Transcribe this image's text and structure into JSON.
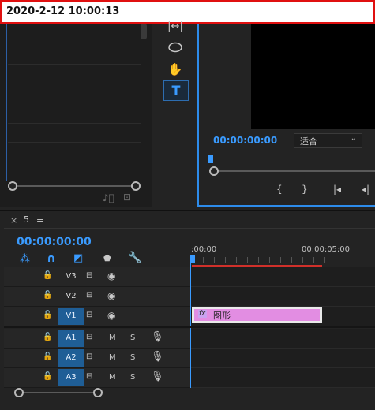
{
  "topbar": {
    "datetime": "2020-2-12 10:00:13"
  },
  "program_monitor": {
    "timecode": "00:00:00:00",
    "fit_option": "适合"
  },
  "timeline": {
    "tab_close": "×",
    "sequence_name": "5",
    "menu_icon": "≡",
    "timecode": "00:00:00:00",
    "ruler_labels": [
      ":00:00",
      "00:00:05:00"
    ],
    "video_tracks": [
      {
        "name": "V3",
        "targeted": false
      },
      {
        "name": "V2",
        "targeted": false
      },
      {
        "name": "V1",
        "targeted": true
      }
    ],
    "audio_tracks": [
      {
        "name": "A1",
        "mute": "M",
        "solo": "S"
      },
      {
        "name": "A2",
        "mute": "M",
        "solo": "S"
      },
      {
        "name": "A3",
        "mute": "M",
        "solo": "S"
      }
    ],
    "clip": {
      "fx": "fx",
      "label": "图形",
      "color": "#e28de2"
    }
  },
  "colors": {
    "accent": "#2d8ceb",
    "timecode": "#3a9bff",
    "target": "#1f5e96",
    "border_red": "#e01010"
  }
}
